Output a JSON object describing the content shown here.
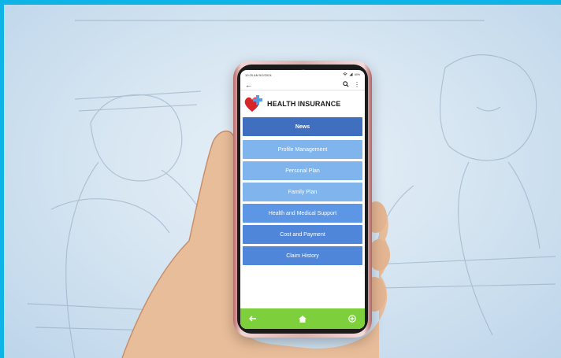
{
  "status_bar": {
    "time": "10:25 AM 5/2/2024",
    "battery": "60%"
  },
  "toolbar": {
    "back_icon": "back-arrow-icon",
    "search_icon": "search-icon",
    "more_icon": "more-vertical-icon"
  },
  "app": {
    "title": "HEALTH INSURANCE"
  },
  "menu": {
    "items": [
      {
        "label": "News"
      },
      {
        "label": "Profile Management"
      },
      {
        "label": "Personal Plan"
      },
      {
        "label": "Family Plan"
      },
      {
        "label": "Health and Medical Support"
      },
      {
        "label": "Cost and Payment"
      },
      {
        "label": "Claim History"
      }
    ]
  },
  "bottom_nav": {
    "back_icon": "back-arrow-icon",
    "home_icon": "home-icon",
    "add_icon": "add-circle-icon"
  },
  "colors": {
    "frame": "#0fb4e6",
    "news": "#3f6fbe",
    "menu_light": "#7fb4ec",
    "menu_mid": "#5d96e4",
    "bottom_bar": "#7dcf3c"
  }
}
